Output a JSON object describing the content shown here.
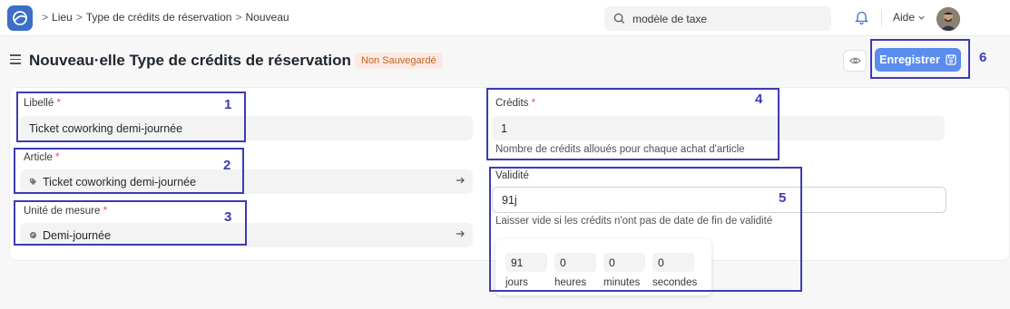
{
  "navbar": {
    "breadcrumb": [
      "Lieu",
      "Type de crédits de réservation",
      "Nouveau"
    ],
    "breadcrumb_separator": ">",
    "search_placeholder": "modèle de taxe",
    "help_label": "Aide"
  },
  "page": {
    "title": "Nouveau·elle Type de crédits de réservation",
    "status_badge": "Non Sauvegardé",
    "save_label": "Enregistrer"
  },
  "form": {
    "libelle": {
      "label": "Libellé",
      "required": "*",
      "value": "Ticket coworking demi-journée"
    },
    "article": {
      "label": "Article",
      "required": "*",
      "value": "Ticket coworking demi-journée"
    },
    "uom": {
      "label": "Unité de mesure",
      "required": "*",
      "value": "Demi-journée"
    },
    "credits": {
      "label": "Crédits",
      "required": "*",
      "value": "1",
      "description": "Nombre de crédits alloués pour chaque achat d'article"
    },
    "validite": {
      "label": "Validité",
      "value": "91j",
      "description": "Laisser vide si les crédits n'ont pas de date de fin de validité"
    }
  },
  "duration_picker": {
    "jours": {
      "label": "jours",
      "value": "91"
    },
    "heures": {
      "label": "heures",
      "value": "0"
    },
    "minutes": {
      "label": "minutes",
      "value": "0"
    },
    "secondes": {
      "label": "secondes",
      "value": "0"
    }
  },
  "annotations": [
    "1",
    "2",
    "3",
    "4",
    "5",
    "6"
  ],
  "colors": {
    "annotation": "#3d3bb3",
    "primary": "#5b8def",
    "badge_bg": "#fde9e2",
    "badge_text": "#c4631d"
  }
}
